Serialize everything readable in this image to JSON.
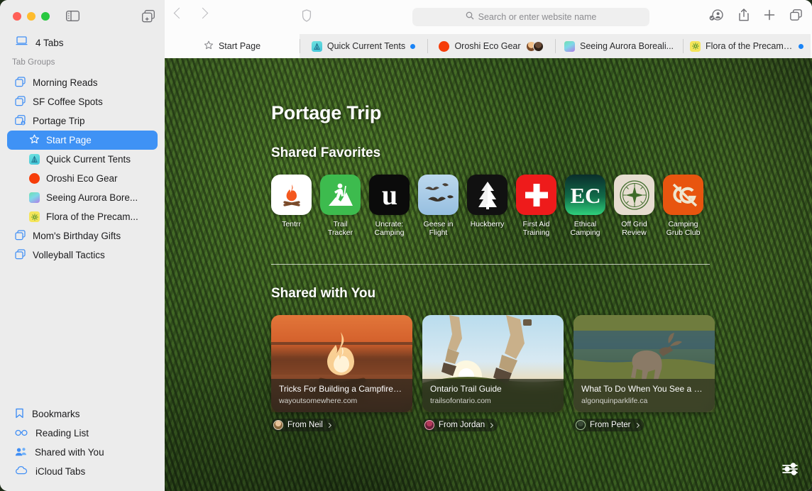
{
  "window": {
    "traffic_lights": [
      "close",
      "minimize",
      "zoom"
    ],
    "sidebar_toggle_icon": "sidebar-toggle-icon",
    "new_tab_group_icon": "new-tab-group-icon"
  },
  "sidebar": {
    "tabs_entry": {
      "label": "4 Tabs",
      "icon": "laptop-icon"
    },
    "group_header": "Tab Groups",
    "groups": [
      {
        "label": "Morning Reads",
        "icon": "tab-group-icon"
      },
      {
        "label": "SF Coffee Spots",
        "icon": "tab-group-icon"
      },
      {
        "label": "Portage Trip",
        "icon": "tab-group-shared-icon"
      }
    ],
    "portage_children": [
      {
        "label": "Start Page",
        "icon": "star-icon",
        "selected": true
      },
      {
        "label": "Quick Current Tents",
        "icon": "site-favicon-tents",
        "selected": false
      },
      {
        "label": "Oroshi Eco Gear",
        "icon": "site-favicon-oroshi",
        "selected": false
      },
      {
        "label": "Seeing Aurora Bore...",
        "icon": "site-favicon-aurora",
        "selected": false
      },
      {
        "label": "Flora of the Precam...",
        "icon": "site-favicon-flora",
        "selected": false
      }
    ],
    "groups_after": [
      {
        "label": "Mom's Birthday Gifts",
        "icon": "tab-group-icon"
      },
      {
        "label": "Volleyball Tactics",
        "icon": "tab-group-icon"
      }
    ],
    "bottom": [
      {
        "label": "Bookmarks",
        "icon": "bookmark-icon"
      },
      {
        "label": "Reading List",
        "icon": "glasses-icon"
      },
      {
        "label": "Shared with You",
        "icon": "people-icon"
      },
      {
        "label": "iCloud Tabs",
        "icon": "cloud-icon"
      }
    ]
  },
  "toolbar": {
    "back_icon": "chevron-left-icon",
    "forward_icon": "chevron-right-icon",
    "shield_icon": "privacy-shield-icon",
    "address_placeholder": "Search or enter website name",
    "search_icon": "search-icon",
    "right_icons": [
      {
        "name": "share-participants-icon"
      },
      {
        "name": "share-icon"
      },
      {
        "name": "new-tab-plus-icon"
      },
      {
        "name": "tab-overview-icon"
      }
    ]
  },
  "tabstrip": {
    "tabs": [
      {
        "title": "Start Page",
        "icon": "star-icon",
        "active": true,
        "badge": "none"
      },
      {
        "title": "Quick Current Tents",
        "icon": "site-favicon-tents",
        "active": false,
        "badge": "blue-dot"
      },
      {
        "title": "Oroshi Eco Gear",
        "icon": "site-favicon-oroshi",
        "active": false,
        "badge": "avatars"
      },
      {
        "title": "Seeing Aurora Boreali...",
        "icon": "site-favicon-aurora",
        "active": false,
        "badge": "none"
      },
      {
        "title": "Flora of the Precambi...",
        "icon": "site-favicon-flora",
        "active": false,
        "badge": "blue-dot"
      }
    ]
  },
  "startpage": {
    "title": "Portage Trip",
    "favorites_heading": "Shared Favorites",
    "favorites": [
      {
        "label": "Tentrr",
        "icon": "campfire-icon",
        "bg": "#ffffff"
      },
      {
        "label": "Trail\nTracker",
        "icon": "hiker-icon",
        "bg": "#3dbb4e"
      },
      {
        "label": "Uncrate:\nCamping",
        "icon": "letter-u-icon",
        "bg": "#0b0b0b"
      },
      {
        "label": "Geese in\nFlight",
        "icon": "geese-icon",
        "bg": "#a8c8e8"
      },
      {
        "label": "Huckberry",
        "icon": "pine-tree-icon",
        "bg": "#111111"
      },
      {
        "label": "First Aid\nTraining",
        "icon": "red-cross-icon",
        "bg": "#ee1b1b"
      },
      {
        "label": "Ethical\nCamping",
        "icon": "ec-monogram-icon",
        "bg": "#0d3b2e"
      },
      {
        "label": "Off Grid\nReview",
        "icon": "compass-icon",
        "bg": "#e6ddd0"
      },
      {
        "label": "Camping\nGrub Club",
        "icon": "cg-monogram-icon",
        "bg": "#e8550f"
      }
    ],
    "shared_heading": "Shared with You",
    "shared_cards": [
      {
        "title": "Tricks For Building a Campfire—F...",
        "url": "wayoutsomewhere.com",
        "from": "From Neil",
        "image": "campfire-photo"
      },
      {
        "title": "Ontario Trail Guide",
        "url": "trailsofontario.com",
        "from": "From Jordan",
        "image": "hikers-sunset-photo"
      },
      {
        "title": "What To Do When You See a Moo...",
        "url": "algonquinparklife.ca",
        "from": "From Peter",
        "image": "moose-pond-photo"
      }
    ],
    "settings_icon": "sliders-icon",
    "accent_color": "#3f92f5",
    "background": "forest-canopy-photo"
  }
}
